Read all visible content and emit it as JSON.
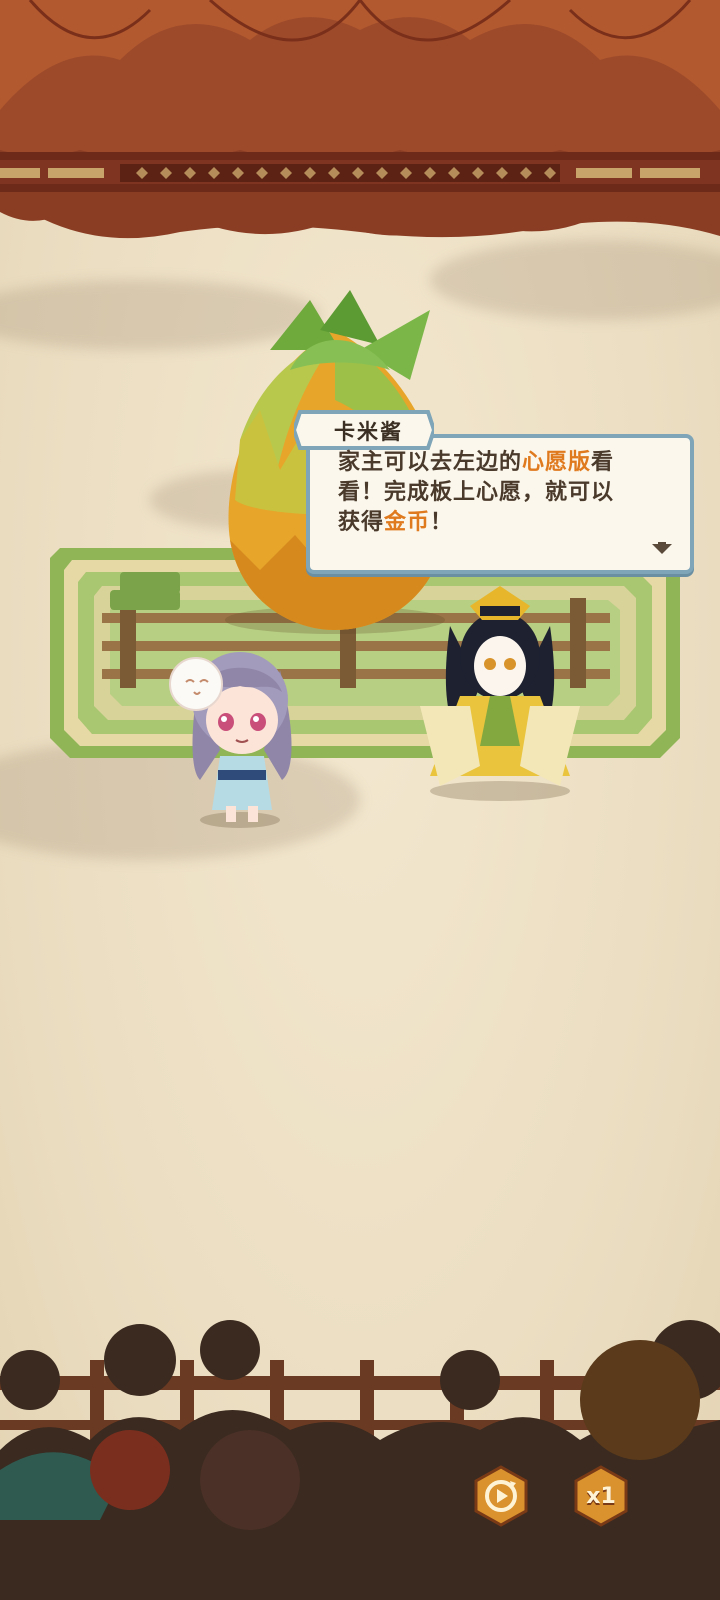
{
  "dialog": {
    "speaker": "卡米酱",
    "line1_a": "家主可以去左边的",
    "line1_hl": "心愿版",
    "line1_b": "看",
    "line2": "看！完成板上心愿，就可以",
    "line3_a": "获得",
    "line3_hl": "金币",
    "line3_b": "！"
  },
  "controls": {
    "auto_icon": "auto-play-icon",
    "speed_label": "x1"
  },
  "colors": {
    "highlight": "#e07a1e",
    "bubble_border": "#7fa5b8",
    "curtain": "#8a3a22",
    "button": "#d9922e"
  }
}
